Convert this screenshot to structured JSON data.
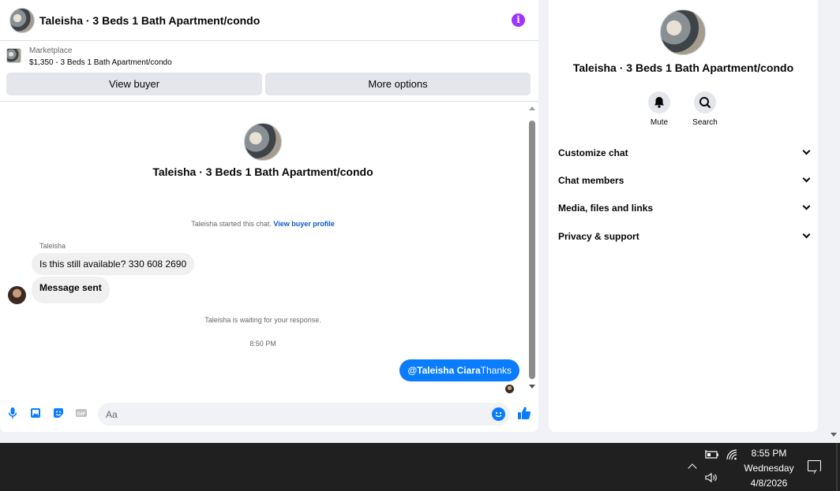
{
  "chat": {
    "title": "Taleisha · 3 Beds 1 Bath Apartment/condo",
    "marketplace_label": "Marketplace",
    "listing": "$1,350 - 3 Beds 1 Bath Apartment/condo",
    "view_buyer_label": "View buyer",
    "more_options_label": "More options",
    "profile_name": "Taleisha · 3 Beds 1 Bath Apartment/condo",
    "started_text": "Taleisha started this chat.",
    "view_profile_link": "View buyer profile",
    "sender_name": "Taleisha",
    "messages": [
      {
        "text": "Is this still available? 330 608 2690"
      },
      {
        "text": "Message sent"
      }
    ],
    "waiting_text": "Taleisha is waiting for your response.",
    "timestamp": "8:50 PM",
    "outgoing": {
      "mention": "@Taleisha Ciara",
      "text": "Thanks"
    },
    "composer_placeholder": "Aa",
    "accent_color": "#0a7cff"
  },
  "info_panel": {
    "name": "Taleisha · 3 Beds 1 Bath Apartment/condo",
    "actions": [
      {
        "label": "Mute",
        "icon": "bell-icon"
      },
      {
        "label": "Search",
        "icon": "search-icon"
      }
    ],
    "sections": [
      {
        "label": "Customize chat"
      },
      {
        "label": "Chat members"
      },
      {
        "label": "Media, files and links"
      },
      {
        "label": "Privacy & support"
      }
    ]
  },
  "taskbar": {
    "time": "8:55 PM",
    "day": "Wednesday",
    "date": "4/8/2026"
  }
}
